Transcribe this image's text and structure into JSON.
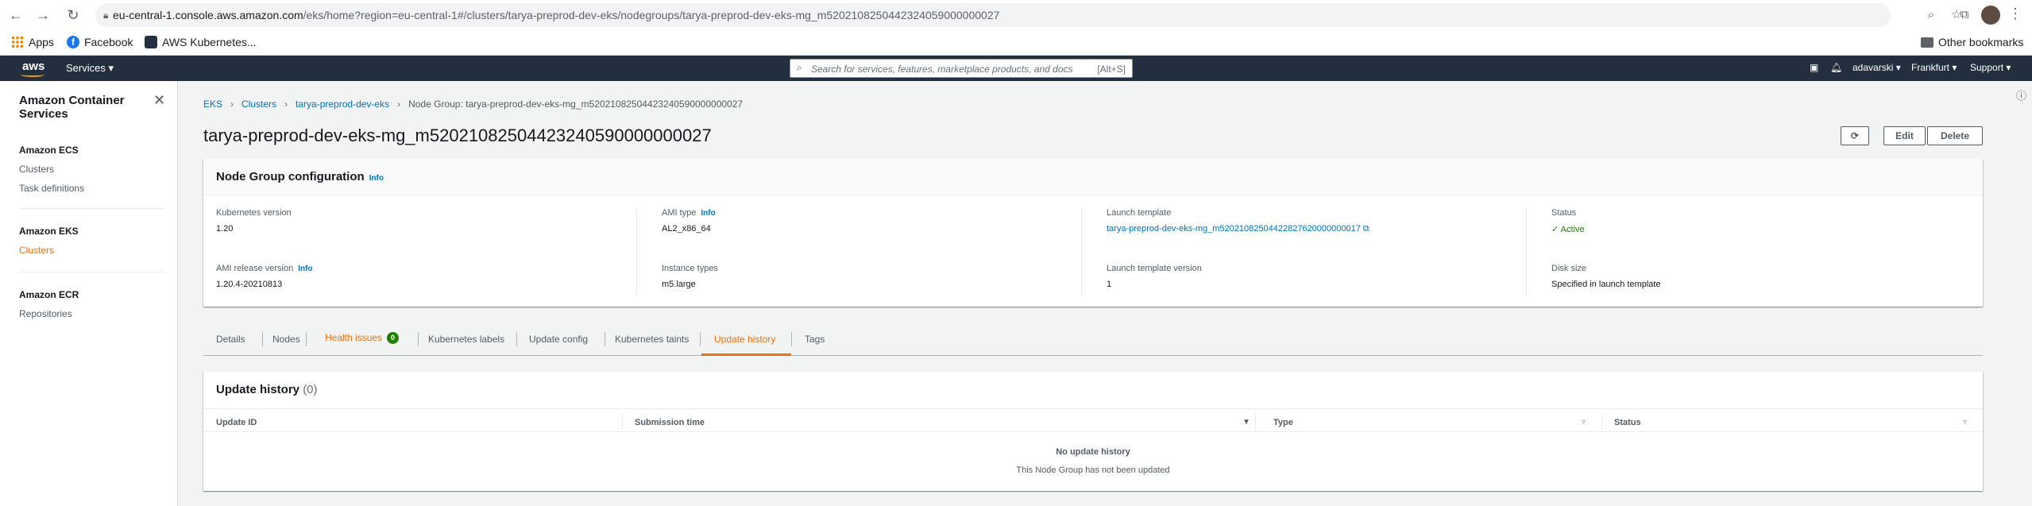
{
  "browser": {
    "url_host": "eu-central-1.console.aws.amazon.com",
    "url_path": "/eks/home?region=eu-central-1#/clusters/tarya-preprod-dev-eks/nodegroups/tarya-preprod-dev-eks-mg_m5202108250442324059000000027",
    "bookmarks": [
      "Apps",
      "Facebook",
      "AWS Kubernetes..."
    ],
    "other_bookmarks": "Other bookmarks"
  },
  "awsnav": {
    "logo": "aws",
    "services": "Services ▾",
    "search_placeholder": "Search for services, features, marketplace products, and docs",
    "search_shortcut": "[Alt+S]",
    "user": "adavarski ▾",
    "region": "Frankfurt ▾",
    "support": "Support ▾"
  },
  "sidebar": {
    "title": "Amazon Container Services",
    "sections": [
      {
        "heading": "Amazon ECS",
        "items": [
          "Clusters",
          "Task definitions"
        ]
      },
      {
        "heading": "Amazon EKS",
        "items": [
          "Clusters"
        ]
      },
      {
        "heading": "Amazon ECR",
        "items": [
          "Repositories"
        ]
      }
    ]
  },
  "breadcrumb": {
    "items": [
      "EKS",
      "Clusters",
      "tarya-preprod-dev-eks"
    ],
    "current": "Node Group: tarya-preprod-dev-eks-mg_m52021082504423240590000000027"
  },
  "page": {
    "title": "tarya-preprod-dev-eks-mg_m52021082504423240590000000027",
    "buttons": {
      "refresh": "⟳",
      "edit": "Edit",
      "delete": "Delete"
    }
  },
  "config": {
    "title": "Node Group configuration",
    "info": "Info",
    "fields": {
      "k8s_version_label": "Kubernetes version",
      "k8s_version": "1.20",
      "ami_type_label": "AMI type",
      "ami_type": "AL2_x86_64",
      "launch_template_label": "Launch template",
      "launch_template": "tarya-preprod-dev-eks-mg_m52021082504422827620000000017",
      "status_label": "Status",
      "status": "Active",
      "ami_release_label": "AMI release version",
      "ami_release": "1.20.4-20210813",
      "instance_types_label": "Instance types",
      "instance_types": "m5.large",
      "lt_version_label": "Launch template version",
      "lt_version": "1",
      "disk_size_label": "Disk size",
      "disk_size": "Specified in launch template"
    }
  },
  "tabs": {
    "details": "Details",
    "nodes": "Nodes",
    "health": "Health issues",
    "health_count": "0",
    "labels": "Kubernetes labels",
    "update_config": "Update config",
    "taints": "Kubernetes taints",
    "update_history": "Update history",
    "tags": "Tags"
  },
  "history": {
    "title": "Update history",
    "count": "(0)",
    "columns": [
      "Update ID",
      "Submission time",
      "Type",
      "Status"
    ],
    "empty_title": "No update history",
    "empty_sub": "This Node Group has not been updated"
  }
}
